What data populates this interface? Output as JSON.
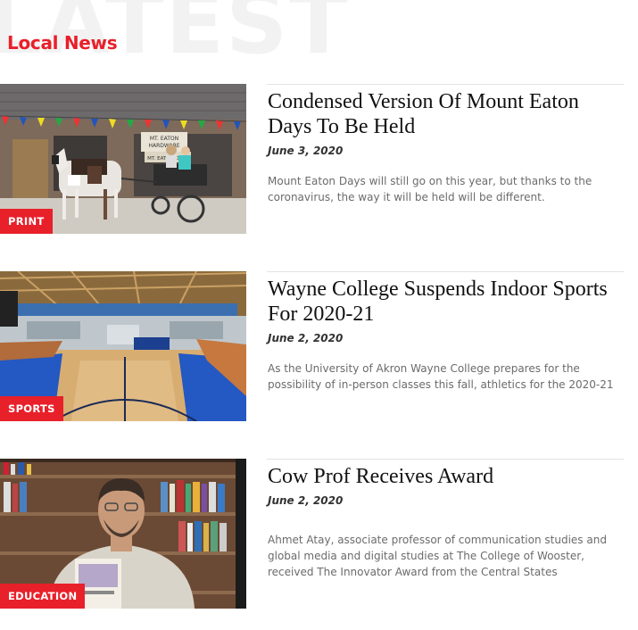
{
  "header": {
    "watermark": "LATEST",
    "section_title": "Local News",
    "accent_color": "#e8202a"
  },
  "articles": [
    {
      "title": "Condensed Version Of Mount Eaton Days To Be Held",
      "date": "June 3, 2020",
      "excerpt": "Mount Eaton Days will still go on this year, but thanks to the coronavirus, the way it will be held will be different.",
      "category": "PRINT",
      "image_subject": "horse-and-buggy-photo",
      "sign_text": [
        "MT. EATON",
        "HARDWARE",
        "MT. EATON DAYS"
      ]
    },
    {
      "title": "Wayne College Suspends Indoor Sports For 2020-21",
      "date": "June 2, 2020",
      "excerpt": "As the University of Akron Wayne College prepares for the possibility of in-person classes this fall, athletics for the 2020-21",
      "category": "SPORTS",
      "image_subject": "gymnasium-photo"
    },
    {
      "title": "Cow Prof Receives Award",
      "date": "June 2, 2020",
      "excerpt": "Ahmet Atay, associate professor of communication studies and global media and digital studies at The College of Wooster, received The Innovator Award from the Central States",
      "category": "EDUCATION",
      "image_subject": "professor-portrait-photo"
    }
  ]
}
